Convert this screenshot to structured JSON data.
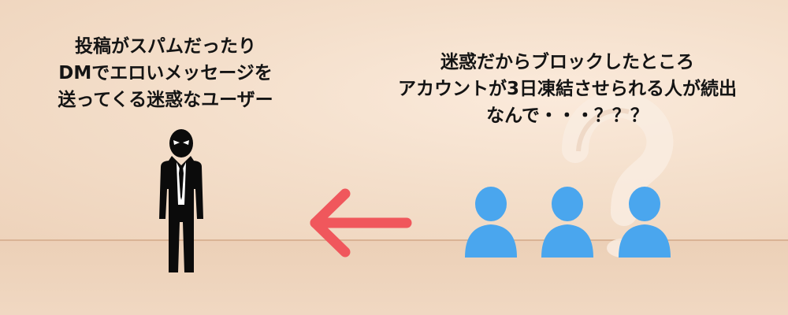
{
  "scene": {
    "left_caption": [
      "投稿がスパムだったり",
      "DMでエロいメッセージを",
      "送ってくる迷惑なユーザー"
    ],
    "right_caption": [
      "迷惑だからブロックしたところ",
      "アカウントが3日凍結させられる人が続出",
      "なんで・・・？？？"
    ]
  },
  "colors": {
    "background": "#f4dfcb",
    "figure": "#0b0b0b",
    "user_icon": "#4aa6ee",
    "arrow": "#f0575c"
  },
  "icons": {
    "spammer": "villain-person-icon",
    "users": "user-icon",
    "arrow": "arrow-left-icon",
    "backdrop": "question-mark-icon"
  }
}
